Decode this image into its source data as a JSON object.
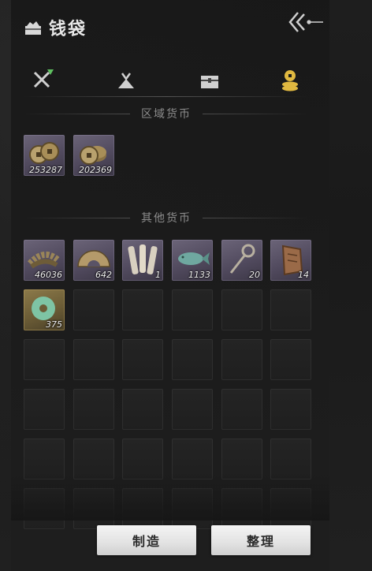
{
  "header": {
    "title": "钱袋",
    "icon": "bag-icon",
    "back_icon": "back-arrow-icon"
  },
  "tabs": [
    {
      "icon": "crossed-swords-icon",
      "active": false
    },
    {
      "icon": "bundle-icon",
      "active": false
    },
    {
      "icon": "chest-icon",
      "active": false
    },
    {
      "icon": "coins-icon",
      "active": true
    }
  ],
  "sections": {
    "regional": {
      "title": "区域货币",
      "items": [
        {
          "icon": "copper-coins-icon",
          "count": "253287"
        },
        {
          "icon": "copper-coins-stack-icon",
          "count": "202369"
        }
      ]
    },
    "other": {
      "title": "其他货币",
      "items": [
        {
          "icon": "coin-string-icon",
          "count": "46036"
        },
        {
          "icon": "half-disc-icon",
          "count": "642"
        },
        {
          "icon": "bamboo-slips-icon",
          "count": "1"
        },
        {
          "icon": "jade-fish-icon",
          "count": "1133"
        },
        {
          "icon": "key-token-icon",
          "count": "20"
        },
        {
          "icon": "bronze-plaque-icon",
          "count": "14"
        },
        {
          "icon": "jade-ring-icon",
          "count": "375"
        }
      ]
    }
  },
  "buttons": {
    "craft": "制造",
    "sort": "整理"
  },
  "colors": {
    "accent_tab": "#e0b840",
    "item_bg": "#5a5366",
    "gold_item_bg": "#7a6a40"
  }
}
